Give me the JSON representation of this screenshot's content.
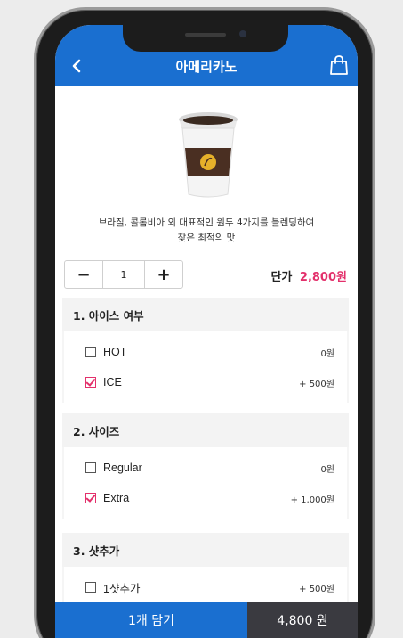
{
  "header": {
    "title": "아메리카노",
    "back_icon": "chevron-left-icon",
    "cart_icon": "shopping-bag-icon",
    "color": "#1a6fd0"
  },
  "product": {
    "image_icon": "coffee-cup-icon",
    "description_line1": "브라질, 콜롬비아 외 대표적인 원두 4가지를 블렌딩하여",
    "description_line2": "찾은 최적의 맛"
  },
  "quantity": {
    "minus_label": "−",
    "value": "1",
    "plus_label": "+"
  },
  "unit_price": {
    "label": "단가",
    "value": "2,800원",
    "color": "#e3306b"
  },
  "groups": [
    {
      "title": "1. 아이스 여부",
      "options": [
        {
          "label": "HOT",
          "price": "0원",
          "checked": false
        },
        {
          "label": "ICE",
          "price": "+ 500원",
          "checked": true
        }
      ]
    },
    {
      "title": "2. 사이즈",
      "options": [
        {
          "label": "Regular",
          "price": "0원",
          "checked": false
        },
        {
          "label": "Extra",
          "price": "+ 1,000원",
          "checked": true
        }
      ]
    },
    {
      "title": "3. 샷추가",
      "options": [
        {
          "label": "1샷추가",
          "price": "+ 500원",
          "checked": false
        }
      ]
    }
  ],
  "bottom": {
    "add_label": "1개 담기",
    "total": "4,800 원"
  }
}
